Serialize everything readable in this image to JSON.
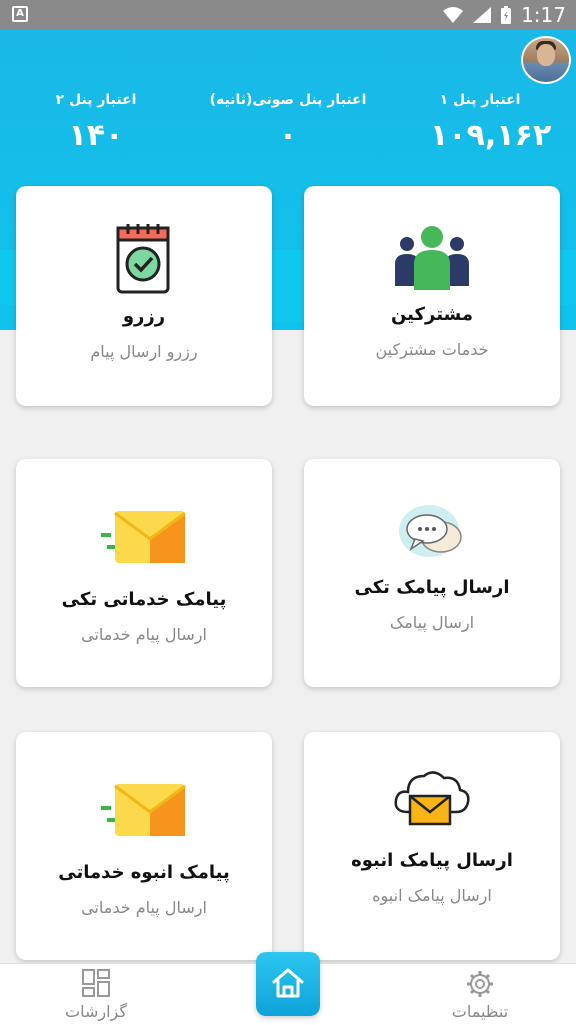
{
  "status_bar": {
    "time": "1:17",
    "indicator": "A"
  },
  "stats": [
    {
      "label": "اعتبار پنل ۱",
      "value": "۱۰۹,۱۶۲"
    },
    {
      "label": "اعتبار پنل صوتی(ثانیه)",
      "value": "۰"
    },
    {
      "label": "اعتبار پنل ۲",
      "value": "۱۴۰"
    }
  ],
  "cards": {
    "customers": {
      "title": "مشترکین",
      "subtitle": "خدمات مشترکین",
      "icon": "users-icon"
    },
    "reserve": {
      "title": "رزرو",
      "subtitle": "رزرو ارسال پیام",
      "icon": "calendar-check-icon"
    },
    "single_sms": {
      "title": "ارسال پیامک تکی",
      "subtitle": "ارسال پیامک",
      "icon": "chat-bubbles-icon"
    },
    "single_service_sms": {
      "title": "پیامک خدماتی تکی",
      "subtitle": "ارسال پیام خدماتی",
      "icon": "fast-envelope-icon"
    },
    "bulk_sms": {
      "title": "ارسال پیامک انبوه",
      "subtitle": "ارسال پیامک انبوه",
      "icon": "cloud-envelope-icon"
    },
    "bulk_service_sms": {
      "title": "پیامک انبوه خدماتی",
      "subtitle": "ارسال پیام خدماتی",
      "icon": "fast-envelope-icon"
    }
  },
  "nav": {
    "settings": "تنظیمات",
    "reports": "گزارشات",
    "home_icon": "home-icon"
  },
  "colors": {
    "header": "#12bde9",
    "accent": "#17b3e6",
    "envelope": "#f9b515"
  }
}
